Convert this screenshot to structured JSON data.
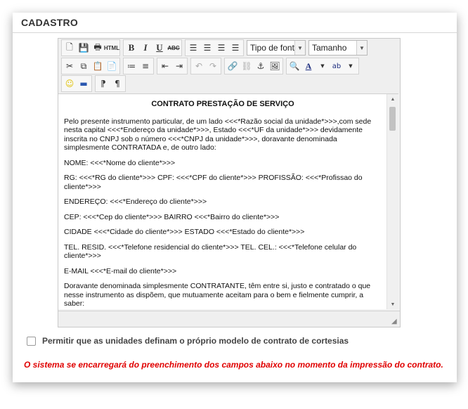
{
  "panel": {
    "title": "CADASTRO"
  },
  "toolbar": {
    "font_select": "Tipo de fonte",
    "size_select": "Tamanho",
    "html_label": "HTML",
    "bold_label": "B",
    "italic_label": "I",
    "underline_label": "U",
    "strike_label": "ABC"
  },
  "document": {
    "heading": "CONTRATO PRESTAÇÃO DE SERVIÇO",
    "paragraphs": [
      "Pelo presente instrumento particular, de um lado <<<*Razão social da unidade*>>>,com sede nesta capital <<<*Endereço da unidade*>>>, Estado <<<*UF da unidade*>>> devidamente inscrita no CNPJ sob o número <<<*CNPJ da unidade*>>>, doravante denominada simplesmente CONTRATADA e, de outro lado:",
      "NOME: <<<*Nome do cliente*>>>",
      "RG: <<<*RG do cliente*>>> CPF: <<<*CPF do cliente*>>> PROFISSÃO: <<<*Profissao do cliente*>>>",
      "ENDEREÇO: <<<*Endereço do cliente*>>>",
      "CEP: <<<*Cep do cliente*>>> BAIRRO <<<*Bairro do cliente*>>>",
      "CIDADE <<<*Cidade do cliente*>>> ESTADO <<<*Estado do cliente*>>>",
      "TEL. RESID. <<<*Telefone residencial do cliente*>>> TEL. CEL.: <<<*Telefone celular do cliente*>>>",
      "E-MAIL <<<*E-mail do cliente*>>>",
      "Doravante denominada simplesmente CONTRATANTE, têm entre si, justo e contratado o que nesse instrumento as dispõem, que mutuamente aceitam para o bem e fielmente cumprir, a saber:"
    ]
  },
  "options": {
    "allow_units_label": "Permitir que as unidades definam o próprio modelo de contrato de cortesias",
    "allow_units_checked": false
  },
  "notice": {
    "text": "O sistema se encarregará do preenchimento dos campos abaixo no momento da impressão do contrato."
  },
  "colors": {
    "notice": "#e00000",
    "title": "#333333"
  }
}
